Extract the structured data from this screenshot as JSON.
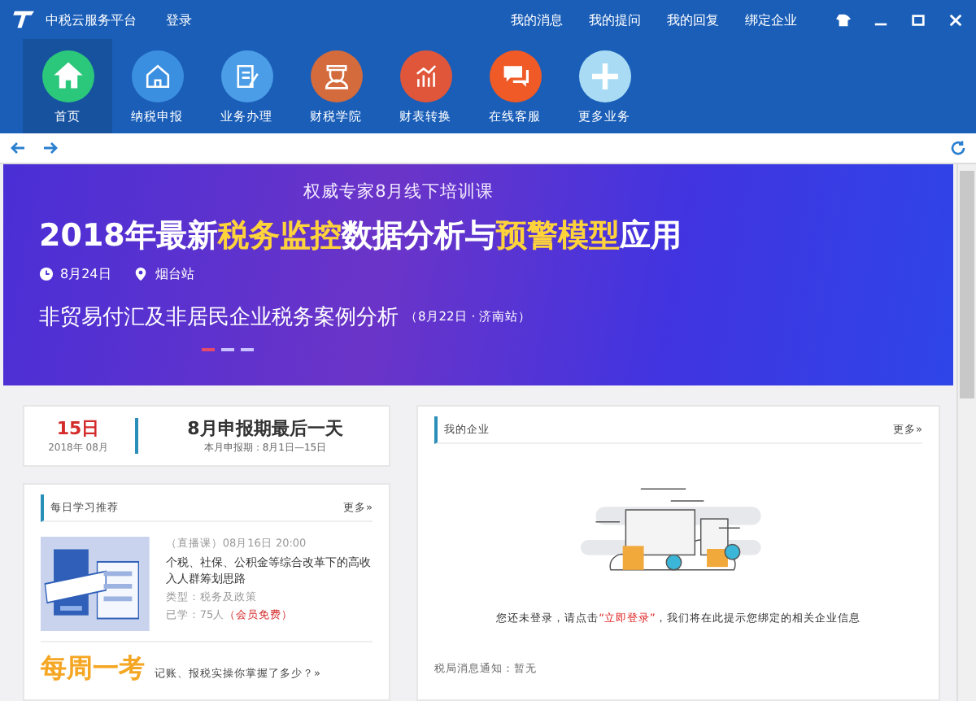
{
  "window": {
    "title": "中税云服务平台",
    "login": "登录",
    "links": [
      "我的消息",
      "我的提问",
      "我的回复",
      "绑定企业"
    ]
  },
  "nav": [
    {
      "label": "首页",
      "kind": "home",
      "color": "#2bc77b",
      "selected": true
    },
    {
      "label": "纳税申报",
      "kind": "house",
      "color": "#3b8fe0",
      "selected": false
    },
    {
      "label": "业务办理",
      "kind": "doc",
      "color": "#4a9de6",
      "selected": false
    },
    {
      "label": "财税学院",
      "kind": "teacher",
      "color": "#d46b3c",
      "selected": false
    },
    {
      "label": "财表转换",
      "kind": "chart",
      "color": "#e0563a",
      "selected": false
    },
    {
      "label": "在线客服",
      "kind": "chat",
      "color": "#ef5a26",
      "selected": false
    },
    {
      "label": "更多业务",
      "kind": "plus",
      "color": "#a9dcf4",
      "selected": false
    }
  ],
  "banner": {
    "kicker": "权威专家8月线下培训课",
    "headline": "2018年最新**税务监控**数据分析与**预警模型**应用",
    "date": "8月24日",
    "place": "烟台站",
    "subtitle": "非贸易付汇及非居民企业税务案例分析",
    "subtitle_note": "（8月22日 · 济南站）",
    "slides": [
      {
        "selected": true
      },
      {
        "selected": false
      },
      {
        "selected": false
      }
    ]
  },
  "deadline": {
    "day": "15日",
    "month": "2018年 08月",
    "title": "8月申报期最后一天",
    "note": "本月申报期：8月1日—15日"
  },
  "study": {
    "title": "每日学习推荐",
    "more": "更多»",
    "course": {
      "time": "（直播课）08月16日 20:00",
      "title": "个税、社保、公积金等综合改革下的高收入人群筹划思路",
      "type": "类型：税务及政策",
      "learned": "已学：75人",
      "tag": "（会员免费）"
    },
    "quiz": {
      "title": "每周一考",
      "prompt": "记账、报税实操你掌握了多少？»"
    }
  },
  "company": {
    "title": "我的企业",
    "more": "更多»",
    "message_before": "您还未登录，请点击",
    "link": "“立即登录”",
    "message_after": "，我们将在此提示您绑定的相关企业信息",
    "notice": "税局消息通知：暂无"
  }
}
